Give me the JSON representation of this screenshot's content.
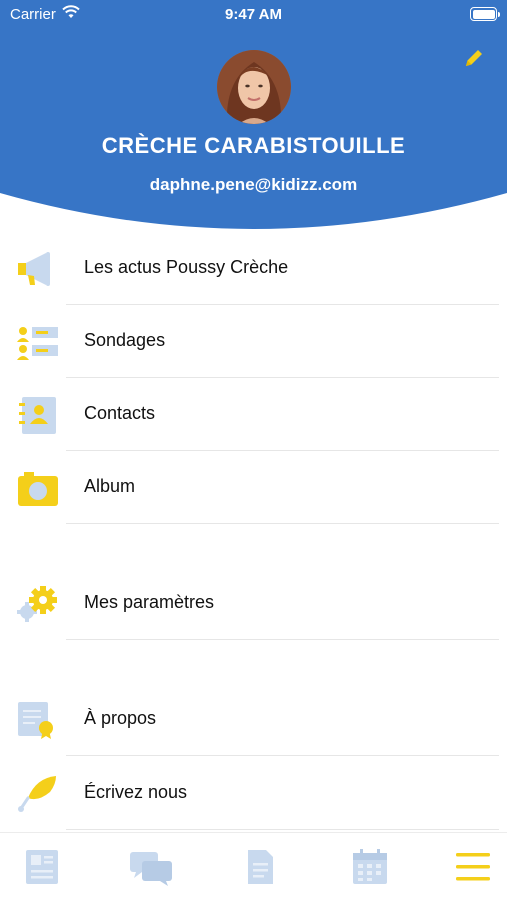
{
  "status_bar": {
    "carrier": "Carrier",
    "time": "9:47 AM"
  },
  "profile": {
    "org_name": "CRÈCHE CARABISTOUILLE",
    "email": "daphne.pene@kidizz.com"
  },
  "menu": [
    {
      "label": "Les actus Poussy Crèche",
      "icon": "megaphone-icon"
    },
    {
      "label": "Sondages",
      "icon": "poll-list-icon"
    },
    {
      "label": "Contacts",
      "icon": "contacts-book-icon"
    },
    {
      "label": "Album",
      "icon": "camera-icon"
    },
    {
      "label": "Mes paramètres",
      "icon": "gear-icon"
    },
    {
      "label": "À propos",
      "icon": "certificate-icon"
    },
    {
      "label": "Écrivez nous",
      "icon": "feather-pen-icon"
    }
  ],
  "tabs": [
    {
      "name": "news",
      "icon": "newspaper-icon"
    },
    {
      "name": "messages",
      "icon": "chat-bubbles-icon"
    },
    {
      "name": "documents",
      "icon": "document-icon"
    },
    {
      "name": "calendar",
      "icon": "calendar-icon"
    },
    {
      "name": "menu",
      "icon": "hamburger-menu-icon",
      "active": true
    }
  ],
  "colors": {
    "header_blue": "#3775c6",
    "accent_yellow": "#f4cf1a",
    "icon_grey_blue": "#c8d9ee"
  }
}
